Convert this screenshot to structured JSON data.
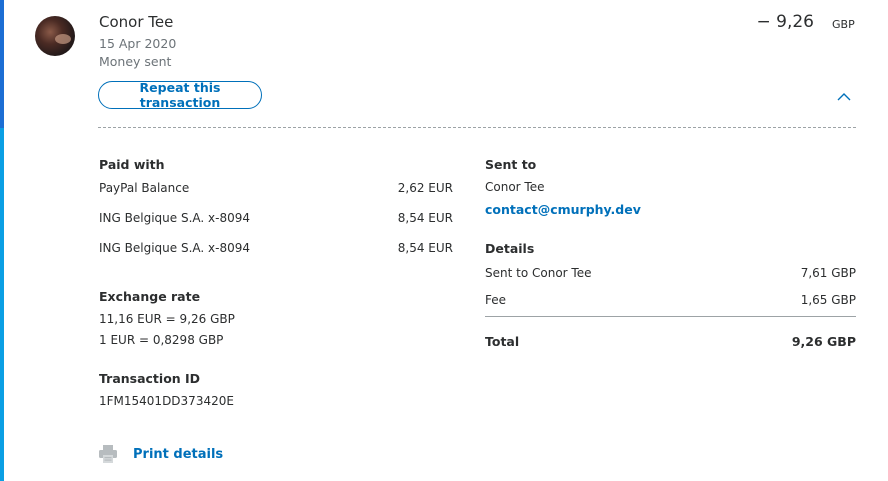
{
  "transaction": {
    "name": "Conor Tee",
    "date": "15 Apr 2020",
    "type": "Money sent",
    "amount": "− 9,26",
    "amount_currency": "GBP",
    "repeat_label": "Repeat this transaction"
  },
  "paid_with": {
    "heading": "Paid with",
    "rows": [
      {
        "label": "PayPal Balance",
        "value": "2,62 EUR"
      },
      {
        "label": "ING Belgique S.A. x-8094",
        "value": "8,54 EUR"
      },
      {
        "label": "ING Belgique S.A. x-8094",
        "value": "8,54 EUR"
      }
    ]
  },
  "exchange_rate": {
    "heading": "Exchange rate",
    "line1": "11,16 EUR = 9,26 GBP",
    "line2": "1 EUR = 0,8298 GBP"
  },
  "transaction_id": {
    "heading": "Transaction ID",
    "value": "1FM15401DD373420E"
  },
  "sent_to": {
    "heading": "Sent to",
    "name": "Conor Tee",
    "email": "contact@cmurphy.dev"
  },
  "details": {
    "heading": "Details",
    "rows": [
      {
        "label": "Sent to Conor Tee",
        "value": "7,61 GBP"
      },
      {
        "label": "Fee",
        "value": "1,65 GBP"
      }
    ],
    "total_label": "Total",
    "total_value": "9,26 GBP"
  },
  "print": {
    "label": "Print details"
  },
  "icons": {
    "collapse": "chevron-up-icon",
    "print": "printer-icon"
  },
  "colors": {
    "accent": "#0070ba",
    "sidebar": "#0a9fe4"
  }
}
